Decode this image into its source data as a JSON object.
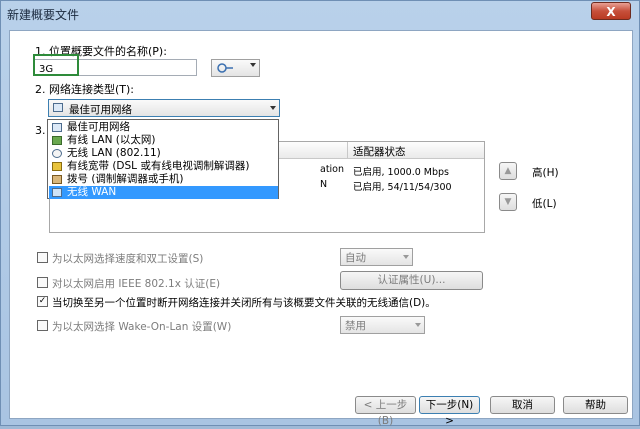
{
  "window": {
    "title": "新建概要文件",
    "close_label": "X"
  },
  "step1": {
    "label": "1. 位置概要文件的名称(P):",
    "value": "3G"
  },
  "step2": {
    "label": "2. 网络连接类型(T):",
    "selected": "最佳可用网络"
  },
  "step3": {
    "label": "3."
  },
  "dropdown_options": [
    {
      "label": "最佳可用网络",
      "icon": "best-network-icon"
    },
    {
      "label": "有线 LAN (以太网)",
      "icon": "wired-lan-icon"
    },
    {
      "label": "无线 LAN (802.11)",
      "icon": "wireless-lan-icon"
    },
    {
      "label": "有线宽带 (DSL 或有线电视调制解调器)",
      "icon": "broadband-icon"
    },
    {
      "label": "拨号 (调制解调器或手机)",
      "icon": "dialup-icon"
    },
    {
      "label": "无线 WAN",
      "icon": "wireless-wan-icon"
    }
  ],
  "adapter_table": {
    "header_status": "适配器状态",
    "rows": [
      {
        "name_tail": "ation",
        "status": "已启用, 1000.0 Mbps"
      },
      {
        "name_tail": "N",
        "status": "已启用, 54/11/54/300"
      }
    ]
  },
  "priority": {
    "high": "高(H)",
    "low": "低(L)"
  },
  "options": {
    "speed_duplex": {
      "label": "为以太网选择速度和双工设置(S)",
      "value": "自动",
      "checked": false
    },
    "ieee_8021x": {
      "label": "对以太网启用 IEEE 802.1x 认证(E)",
      "button": "认证属性(U)...",
      "checked": false
    },
    "disconnect": {
      "label": "当切换至另一个位置时断开网络连接并关闭所有与该概要文件关联的无线通信(D)。",
      "checked": true
    },
    "wol": {
      "label": "为以太网选择 Wake-On-Lan 设置(W)",
      "value": "禁用",
      "checked": false
    }
  },
  "buttons": {
    "back": "< 上一步(B)",
    "next": "下一步(N) >",
    "cancel": "取消",
    "help": "帮助"
  },
  "colors": {
    "selection": "#3399ff",
    "name_highlight": "#2e8b3a"
  }
}
